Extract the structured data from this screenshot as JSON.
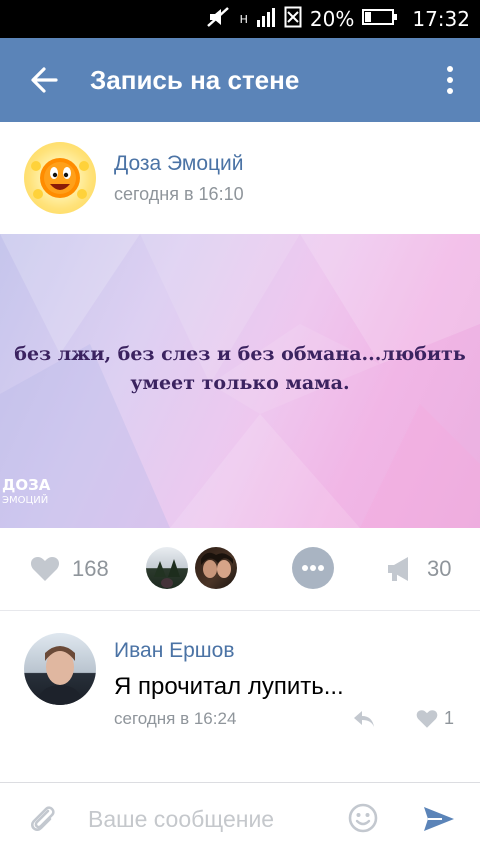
{
  "status_bar": {
    "network_label": "H",
    "battery_percent": "20%",
    "time": "17:32"
  },
  "app_bar": {
    "title": "Запись на стене",
    "back_icon": "arrow-back-icon",
    "more_icon": "more-vert-icon"
  },
  "post": {
    "author": "Доза Эмоций",
    "time": "сегодня в 16:10",
    "image": {
      "text_line1": "без лжи, без слез и без обмана...любить",
      "text_line2": "умеет только мама.",
      "watermark_line1": "ДОЗА",
      "watermark_line2": "ЭМОЦИЙ"
    },
    "likes": "168",
    "shares": "30"
  },
  "comment": {
    "author": "Иван Ершов",
    "text": "Я прочитал лупить...",
    "time": "сегодня в 16:24",
    "likes": "1"
  },
  "composer": {
    "placeholder": "Ваше сообщение"
  },
  "colors": {
    "app_bar": "#5b84b8",
    "link": "#4b73a5",
    "muted": "#8f959b"
  }
}
